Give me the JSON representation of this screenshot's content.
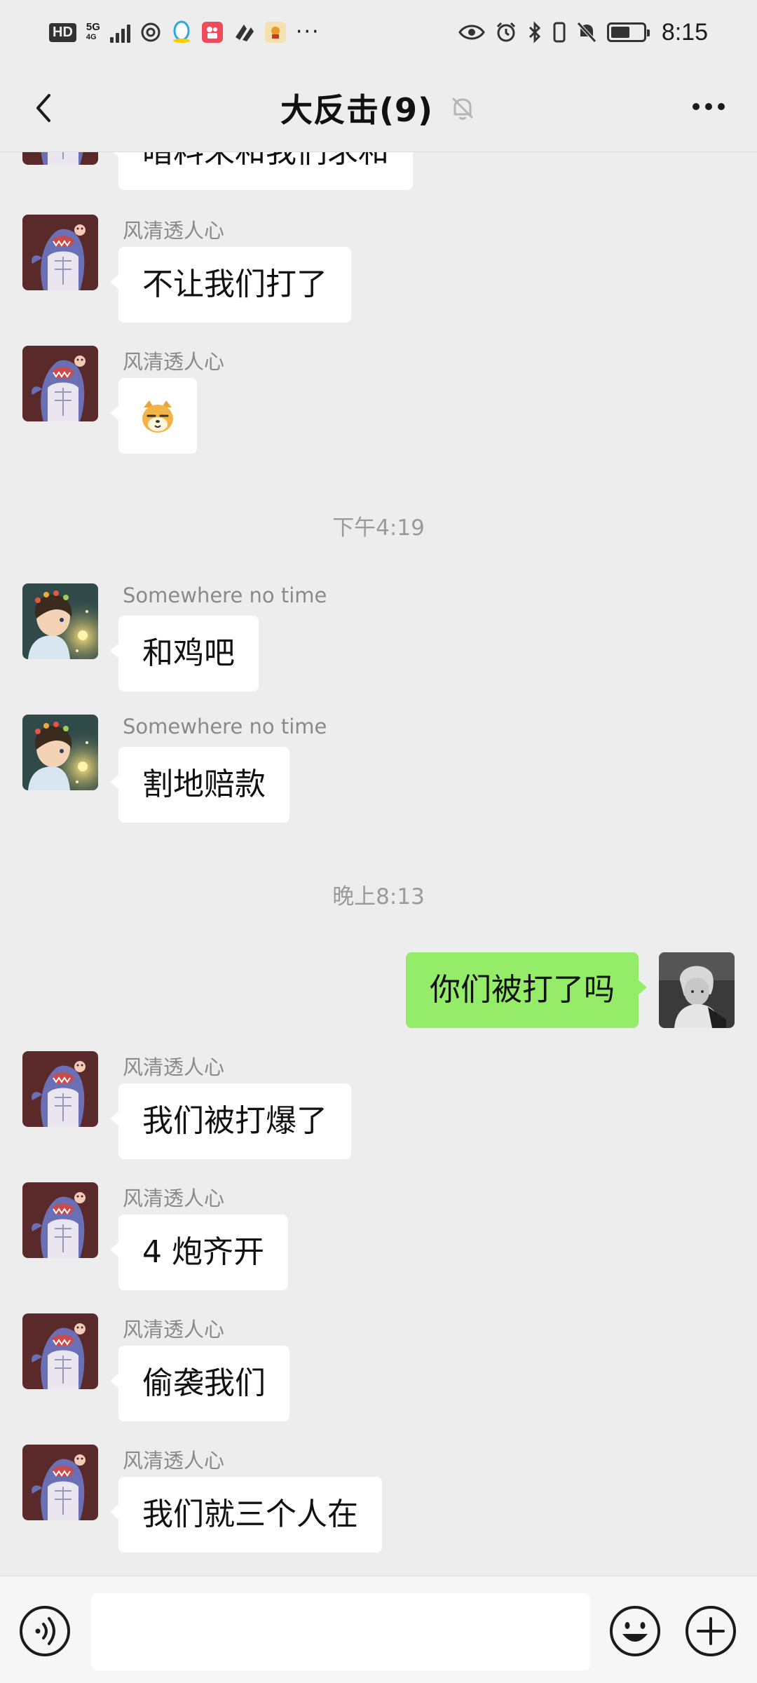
{
  "status_bar": {
    "hd": "HD",
    "network_type": "5G",
    "network_sub": "4G",
    "dots": "···",
    "time": "8:15",
    "battery_level": 0.6
  },
  "header": {
    "title": "大反击(9)",
    "icons": {
      "back": "chevron-left-icon",
      "mute": "bell-off-icon",
      "more": "more-dots-icon"
    }
  },
  "messages": [
    {
      "type": "incoming",
      "sender": "",
      "text": "暗料来和我们求和",
      "avatar": "shark-avatar"
    },
    {
      "type": "incoming",
      "sender": "风清透人心",
      "text": "不让我们打了",
      "avatar": "shark-avatar"
    },
    {
      "type": "incoming",
      "sender": "风清透人心",
      "text": "",
      "sticker": "doge-emoji",
      "avatar": "shark-avatar"
    },
    {
      "type": "time",
      "text": "下午4:19"
    },
    {
      "type": "incoming",
      "sender": "Somewhere no time",
      "text": "和鸡吧",
      "avatar": "boy-avatar"
    },
    {
      "type": "incoming",
      "sender": "Somewhere no time",
      "text": "割地赔款",
      "avatar": "boy-avatar"
    },
    {
      "type": "time",
      "text": "晚上8:13"
    },
    {
      "type": "outgoing",
      "text": "你们被打了吗",
      "avatar": "gray-avatar"
    },
    {
      "type": "incoming",
      "sender": "风清透人心",
      "text": "我们被打爆了",
      "avatar": "shark-avatar"
    },
    {
      "type": "incoming",
      "sender": "风清透人心",
      "text": "4 炮齐开",
      "avatar": "shark-avatar"
    },
    {
      "type": "incoming",
      "sender": "风清透人心",
      "text": "偷袭我们",
      "avatar": "shark-avatar"
    },
    {
      "type": "incoming",
      "sender": "风清透人心",
      "text": "我们就三个人在",
      "avatar": "shark-avatar"
    }
  ],
  "input_bar": {
    "placeholder": "",
    "icons": {
      "voice": "voice-icon",
      "emoji": "emoji-icon",
      "plus": "plus-icon"
    }
  },
  "colors": {
    "background": "#ededed",
    "incoming_bubble": "#ffffff",
    "outgoing_bubble": "#95ec69",
    "sender_text": "#8a8a8a",
    "timestamp_text": "#9a9a9a"
  }
}
